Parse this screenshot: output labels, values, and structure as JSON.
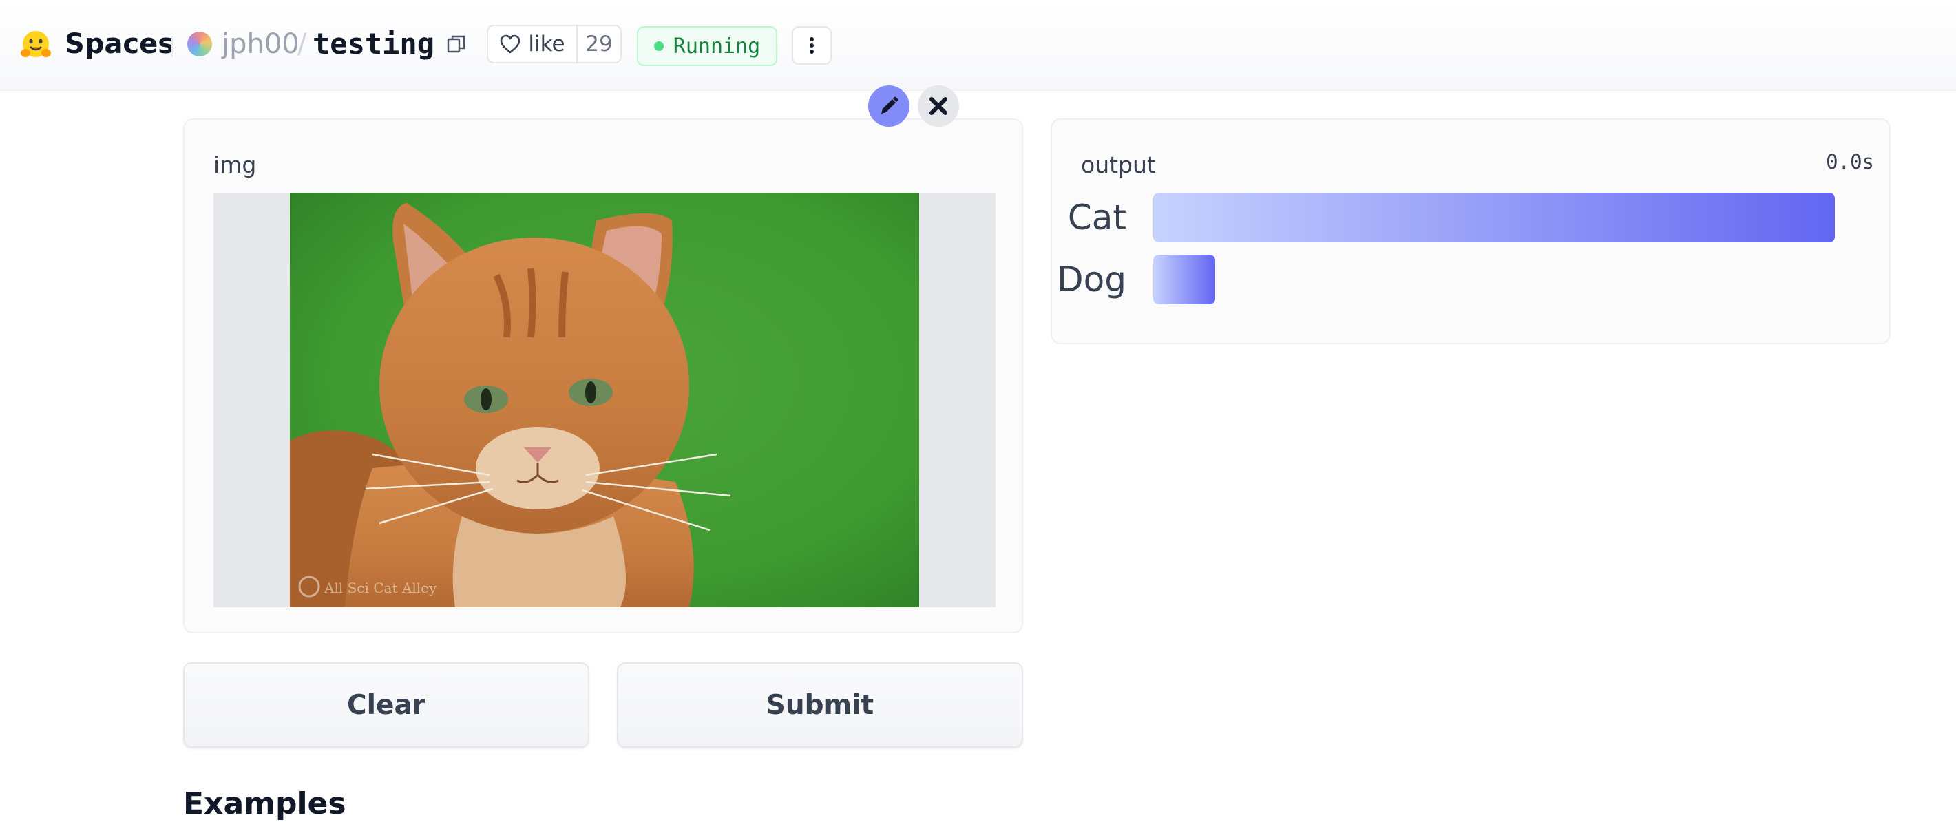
{
  "header": {
    "brand": "Spaces",
    "repo_owner": "jph00",
    "repo_separator": "/",
    "repo_name": "testing",
    "like_label": "like",
    "like_count": "29",
    "status": "Running",
    "status_color": "#15803d"
  },
  "input": {
    "label": "img",
    "watermark": "All Sci Cat Alley"
  },
  "output": {
    "label": "output",
    "elapsed": "0.0s",
    "labels": [
      {
        "name": "Cat",
        "confidence": 0.99
      },
      {
        "name": "Dog",
        "confidence": 0.09
      }
    ],
    "bar_color_start": "#c7d2fe",
    "bar_color_end": "#6366f1"
  },
  "buttons": {
    "clear": "Clear",
    "submit": "Submit"
  },
  "examples": {
    "title": "Examples"
  },
  "icons": {
    "logo": "hugging-face-emoji",
    "copy": "copy-icon",
    "heart": "heart-icon",
    "more": "kebab-icon",
    "edit": "pencil-icon",
    "close": "close-icon"
  }
}
